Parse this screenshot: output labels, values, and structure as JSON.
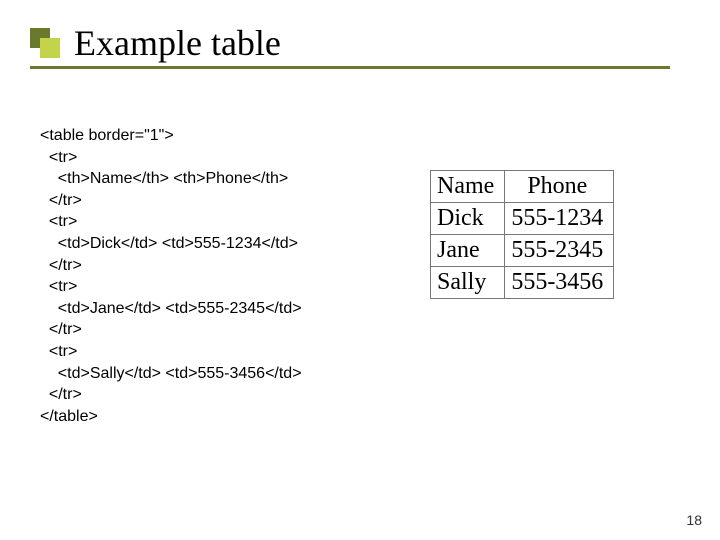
{
  "title": "Example table",
  "code_lines": [
    "<table border=\"1\">",
    "  <tr>",
    "    <th>Name</th> <th>Phone</th>",
    "  </tr>",
    "  <tr>",
    "    <td>Dick</td> <td>555-1234</td>",
    "  </tr>",
    "  <tr>",
    "    <td>Jane</td> <td>555-2345</td>",
    "  </tr>",
    "  <tr>",
    "    <td>Sally</td> <td>555-3456</td>",
    "  </tr>",
    "</table>"
  ],
  "table": {
    "headers": [
      "Name",
      "Phone"
    ],
    "rows": [
      {
        "name": "Dick",
        "phone": "555-1234"
      },
      {
        "name": "Jane",
        "phone": "555-2345"
      },
      {
        "name": "Sally",
        "phone": "555-3456"
      }
    ]
  },
  "page_number": "18"
}
